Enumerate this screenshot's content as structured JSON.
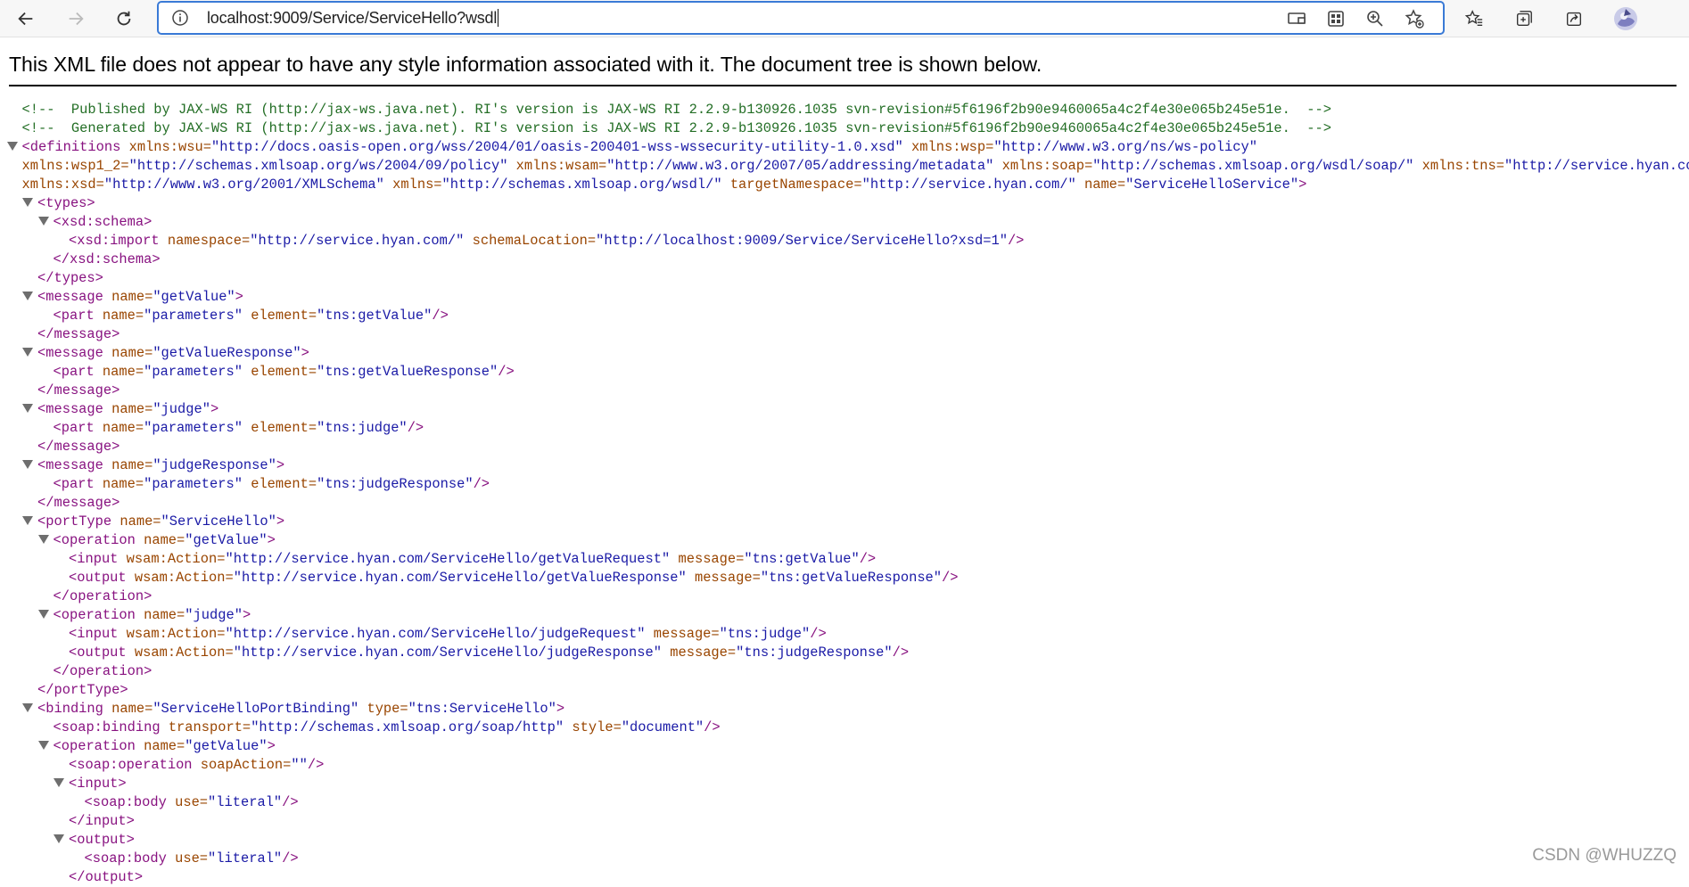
{
  "browser": {
    "url": "localhost:9009/Service/ServiceHello?wsdl",
    "icons": {
      "back": "arrow-left-icon",
      "forward": "arrow-right-icon",
      "reload": "reload-icon",
      "info": "info-icon",
      "cast": "cast-icon",
      "apps": "apps-grid-icon",
      "zoom": "zoom-in-icon",
      "favorite_add": "star-plus-icon",
      "favorites": "favorites-icon",
      "collections": "collections-icon",
      "share": "share-icon",
      "profile": "profile-avatar"
    }
  },
  "page": {
    "banner": "This XML file does not appear to have any style information associated with it. The document tree is shown below.",
    "watermark": "CSDN @WHUZZQ"
  },
  "xml_lines": [
    {
      "indent": 1,
      "toggle": false,
      "tokens": [
        {
          "t": "<!--  Published by JAX-WS RI (http://jax-ws.java.net). RI's version is JAX-WS RI 2.2.9-b130926.1035 svn-revision#5f6196f2b90e9460065a4c2f4e30e065b245e51e.  -->",
          "k": "c"
        }
      ]
    },
    {
      "indent": 1,
      "toggle": false,
      "tokens": [
        {
          "t": "<!--  Generated by JAX-WS RI (http://jax-ws.java.net). RI's version is JAX-WS RI 2.2.9-b130926.1035 svn-revision#5f6196f2b90e9460065a4c2f4e30e065b245e51e.  -->",
          "k": "c"
        }
      ]
    },
    {
      "indent": 1,
      "toggle": true,
      "tokens": [
        {
          "t": "<definitions",
          "k": "t"
        },
        {
          "t": " xmlns:wsu=",
          "k": "a"
        },
        {
          "t": "\"http://docs.oasis-open.org/wss/2004/01/oasis-200401-wss-wssecurity-utility-1.0.xsd\"",
          "k": "v"
        },
        {
          "t": " xmlns:wsp=",
          "k": "a"
        },
        {
          "t": "\"http://www.w3.org/ns/ws-policy\"",
          "k": "v"
        }
      ]
    },
    {
      "indent": 1,
      "toggle": false,
      "tokens": [
        {
          "t": "xmlns:wsp1_2=",
          "k": "a"
        },
        {
          "t": "\"http://schemas.xmlsoap.org/ws/2004/09/policy\"",
          "k": "v"
        },
        {
          "t": " xmlns:wsam=",
          "k": "a"
        },
        {
          "t": "\"http://www.w3.org/2007/05/addressing/metadata\"",
          "k": "v"
        },
        {
          "t": " xmlns:soap=",
          "k": "a"
        },
        {
          "t": "\"http://schemas.xmlsoap.org/wsdl/soap/\"",
          "k": "v"
        },
        {
          "t": " xmlns:tns=",
          "k": "a"
        },
        {
          "t": "\"http://service.hyan.com/\"",
          "k": "v"
        }
      ]
    },
    {
      "indent": 1,
      "toggle": false,
      "tokens": [
        {
          "t": "xmlns:xsd=",
          "k": "a"
        },
        {
          "t": "\"http://www.w3.org/2001/XMLSchema\"",
          "k": "v"
        },
        {
          "t": " xmlns=",
          "k": "a"
        },
        {
          "t": "\"http://schemas.xmlsoap.org/wsdl/\"",
          "k": "v"
        },
        {
          "t": " targetNamespace=",
          "k": "a"
        },
        {
          "t": "\"http://service.hyan.com/\"",
          "k": "v"
        },
        {
          "t": " name=",
          "k": "a"
        },
        {
          "t": "\"ServiceHelloService\"",
          "k": "v"
        },
        {
          "t": ">",
          "k": "t"
        }
      ]
    },
    {
      "indent": 2,
      "toggle": true,
      "tokens": [
        {
          "t": "<types>",
          "k": "t"
        }
      ]
    },
    {
      "indent": 3,
      "toggle": true,
      "tokens": [
        {
          "t": "<xsd:schema>",
          "k": "t"
        }
      ]
    },
    {
      "indent": 4,
      "toggle": false,
      "tokens": [
        {
          "t": "<xsd:import",
          "k": "t"
        },
        {
          "t": " namespace=",
          "k": "a"
        },
        {
          "t": "\"http://service.hyan.com/\"",
          "k": "v"
        },
        {
          "t": " schemaLocation=",
          "k": "a"
        },
        {
          "t": "\"http://localhost:9009/Service/ServiceHello?xsd=1\"",
          "k": "v"
        },
        {
          "t": "/>",
          "k": "t"
        }
      ]
    },
    {
      "indent": 3,
      "toggle": false,
      "tokens": [
        {
          "t": "</xsd:schema>",
          "k": "t"
        }
      ]
    },
    {
      "indent": 2,
      "toggle": false,
      "tokens": [
        {
          "t": "</types>",
          "k": "t"
        }
      ]
    },
    {
      "indent": 2,
      "toggle": true,
      "tokens": [
        {
          "t": "<message",
          "k": "t"
        },
        {
          "t": " name=",
          "k": "a"
        },
        {
          "t": "\"getValue\"",
          "k": "v"
        },
        {
          "t": ">",
          "k": "t"
        }
      ]
    },
    {
      "indent": 3,
      "toggle": false,
      "tokens": [
        {
          "t": "<part",
          "k": "t"
        },
        {
          "t": " name=",
          "k": "a"
        },
        {
          "t": "\"parameters\"",
          "k": "v"
        },
        {
          "t": " element=",
          "k": "a"
        },
        {
          "t": "\"tns:getValue\"",
          "k": "v"
        },
        {
          "t": "/>",
          "k": "t"
        }
      ]
    },
    {
      "indent": 2,
      "toggle": false,
      "tokens": [
        {
          "t": "</message>",
          "k": "t"
        }
      ]
    },
    {
      "indent": 2,
      "toggle": true,
      "tokens": [
        {
          "t": "<message",
          "k": "t"
        },
        {
          "t": " name=",
          "k": "a"
        },
        {
          "t": "\"getValueResponse\"",
          "k": "v"
        },
        {
          "t": ">",
          "k": "t"
        }
      ]
    },
    {
      "indent": 3,
      "toggle": false,
      "tokens": [
        {
          "t": "<part",
          "k": "t"
        },
        {
          "t": " name=",
          "k": "a"
        },
        {
          "t": "\"parameters\"",
          "k": "v"
        },
        {
          "t": " element=",
          "k": "a"
        },
        {
          "t": "\"tns:getValueResponse\"",
          "k": "v"
        },
        {
          "t": "/>",
          "k": "t"
        }
      ]
    },
    {
      "indent": 2,
      "toggle": false,
      "tokens": [
        {
          "t": "</message>",
          "k": "t"
        }
      ]
    },
    {
      "indent": 2,
      "toggle": true,
      "tokens": [
        {
          "t": "<message",
          "k": "t"
        },
        {
          "t": " name=",
          "k": "a"
        },
        {
          "t": "\"judge\"",
          "k": "v"
        },
        {
          "t": ">",
          "k": "t"
        }
      ]
    },
    {
      "indent": 3,
      "toggle": false,
      "tokens": [
        {
          "t": "<part",
          "k": "t"
        },
        {
          "t": " name=",
          "k": "a"
        },
        {
          "t": "\"parameters\"",
          "k": "v"
        },
        {
          "t": " element=",
          "k": "a"
        },
        {
          "t": "\"tns:judge\"",
          "k": "v"
        },
        {
          "t": "/>",
          "k": "t"
        }
      ]
    },
    {
      "indent": 2,
      "toggle": false,
      "tokens": [
        {
          "t": "</message>",
          "k": "t"
        }
      ]
    },
    {
      "indent": 2,
      "toggle": true,
      "tokens": [
        {
          "t": "<message",
          "k": "t"
        },
        {
          "t": " name=",
          "k": "a"
        },
        {
          "t": "\"judgeResponse\"",
          "k": "v"
        },
        {
          "t": ">",
          "k": "t"
        }
      ]
    },
    {
      "indent": 3,
      "toggle": false,
      "tokens": [
        {
          "t": "<part",
          "k": "t"
        },
        {
          "t": " name=",
          "k": "a"
        },
        {
          "t": "\"parameters\"",
          "k": "v"
        },
        {
          "t": " element=",
          "k": "a"
        },
        {
          "t": "\"tns:judgeResponse\"",
          "k": "v"
        },
        {
          "t": "/>",
          "k": "t"
        }
      ]
    },
    {
      "indent": 2,
      "toggle": false,
      "tokens": [
        {
          "t": "</message>",
          "k": "t"
        }
      ]
    },
    {
      "indent": 2,
      "toggle": true,
      "tokens": [
        {
          "t": "<portType",
          "k": "t"
        },
        {
          "t": " name=",
          "k": "a"
        },
        {
          "t": "\"ServiceHello\"",
          "k": "v"
        },
        {
          "t": ">",
          "k": "t"
        }
      ]
    },
    {
      "indent": 3,
      "toggle": true,
      "tokens": [
        {
          "t": "<operation",
          "k": "t"
        },
        {
          "t": " name=",
          "k": "a"
        },
        {
          "t": "\"getValue\"",
          "k": "v"
        },
        {
          "t": ">",
          "k": "t"
        }
      ]
    },
    {
      "indent": 4,
      "toggle": false,
      "tokens": [
        {
          "t": "<input",
          "k": "t"
        },
        {
          "t": " wsam:Action=",
          "k": "a"
        },
        {
          "t": "\"http://service.hyan.com/ServiceHello/getValueRequest\"",
          "k": "v"
        },
        {
          "t": " message=",
          "k": "a"
        },
        {
          "t": "\"tns:getValue\"",
          "k": "v"
        },
        {
          "t": "/>",
          "k": "t"
        }
      ]
    },
    {
      "indent": 4,
      "toggle": false,
      "tokens": [
        {
          "t": "<output",
          "k": "t"
        },
        {
          "t": " wsam:Action=",
          "k": "a"
        },
        {
          "t": "\"http://service.hyan.com/ServiceHello/getValueResponse\"",
          "k": "v"
        },
        {
          "t": " message=",
          "k": "a"
        },
        {
          "t": "\"tns:getValueResponse\"",
          "k": "v"
        },
        {
          "t": "/>",
          "k": "t"
        }
      ]
    },
    {
      "indent": 3,
      "toggle": false,
      "tokens": [
        {
          "t": "</operation>",
          "k": "t"
        }
      ]
    },
    {
      "indent": 3,
      "toggle": true,
      "tokens": [
        {
          "t": "<operation",
          "k": "t"
        },
        {
          "t": " name=",
          "k": "a"
        },
        {
          "t": "\"judge\"",
          "k": "v"
        },
        {
          "t": ">",
          "k": "t"
        }
      ]
    },
    {
      "indent": 4,
      "toggle": false,
      "tokens": [
        {
          "t": "<input",
          "k": "t"
        },
        {
          "t": " wsam:Action=",
          "k": "a"
        },
        {
          "t": "\"http://service.hyan.com/ServiceHello/judgeRequest\"",
          "k": "v"
        },
        {
          "t": " message=",
          "k": "a"
        },
        {
          "t": "\"tns:judge\"",
          "k": "v"
        },
        {
          "t": "/>",
          "k": "t"
        }
      ]
    },
    {
      "indent": 4,
      "toggle": false,
      "tokens": [
        {
          "t": "<output",
          "k": "t"
        },
        {
          "t": " wsam:Action=",
          "k": "a"
        },
        {
          "t": "\"http://service.hyan.com/ServiceHello/judgeResponse\"",
          "k": "v"
        },
        {
          "t": " message=",
          "k": "a"
        },
        {
          "t": "\"tns:judgeResponse\"",
          "k": "v"
        },
        {
          "t": "/>",
          "k": "t"
        }
      ]
    },
    {
      "indent": 3,
      "toggle": false,
      "tokens": [
        {
          "t": "</operation>",
          "k": "t"
        }
      ]
    },
    {
      "indent": 2,
      "toggle": false,
      "tokens": [
        {
          "t": "</portType>",
          "k": "t"
        }
      ]
    },
    {
      "indent": 2,
      "toggle": true,
      "tokens": [
        {
          "t": "<binding",
          "k": "t"
        },
        {
          "t": " name=",
          "k": "a"
        },
        {
          "t": "\"ServiceHelloPortBinding\"",
          "k": "v"
        },
        {
          "t": " type=",
          "k": "a"
        },
        {
          "t": "\"tns:ServiceHello\"",
          "k": "v"
        },
        {
          "t": ">",
          "k": "t"
        }
      ]
    },
    {
      "indent": 3,
      "toggle": false,
      "tokens": [
        {
          "t": "<soap:binding",
          "k": "t"
        },
        {
          "t": " transport=",
          "k": "a"
        },
        {
          "t": "\"http://schemas.xmlsoap.org/soap/http\"",
          "k": "v"
        },
        {
          "t": " style=",
          "k": "a"
        },
        {
          "t": "\"document\"",
          "k": "v"
        },
        {
          "t": "/>",
          "k": "t"
        }
      ]
    },
    {
      "indent": 3,
      "toggle": true,
      "tokens": [
        {
          "t": "<operation",
          "k": "t"
        },
        {
          "t": " name=",
          "k": "a"
        },
        {
          "t": "\"getValue\"",
          "k": "v"
        },
        {
          "t": ">",
          "k": "t"
        }
      ]
    },
    {
      "indent": 4,
      "toggle": false,
      "tokens": [
        {
          "t": "<soap:operation",
          "k": "t"
        },
        {
          "t": " soapAction=",
          "k": "a"
        },
        {
          "t": "\"\"",
          "k": "v"
        },
        {
          "t": "/>",
          "k": "t"
        }
      ]
    },
    {
      "indent": 4,
      "toggle": true,
      "tokens": [
        {
          "t": "<input>",
          "k": "t"
        }
      ]
    },
    {
      "indent": 5,
      "toggle": false,
      "tokens": [
        {
          "t": "<soap:body",
          "k": "t"
        },
        {
          "t": " use=",
          "k": "a"
        },
        {
          "t": "\"literal\"",
          "k": "v"
        },
        {
          "t": "/>",
          "k": "t"
        }
      ]
    },
    {
      "indent": 4,
      "toggle": false,
      "tokens": [
        {
          "t": "</input>",
          "k": "t"
        }
      ]
    },
    {
      "indent": 4,
      "toggle": true,
      "tokens": [
        {
          "t": "<output>",
          "k": "t"
        }
      ]
    },
    {
      "indent": 5,
      "toggle": false,
      "tokens": [
        {
          "t": "<soap:body",
          "k": "t"
        },
        {
          "t": " use=",
          "k": "a"
        },
        {
          "t": "\"literal\"",
          "k": "v"
        },
        {
          "t": "/>",
          "k": "t"
        }
      ]
    },
    {
      "indent": 4,
      "toggle": false,
      "tokens": [
        {
          "t": "</output>",
          "k": "t"
        }
      ]
    }
  ]
}
